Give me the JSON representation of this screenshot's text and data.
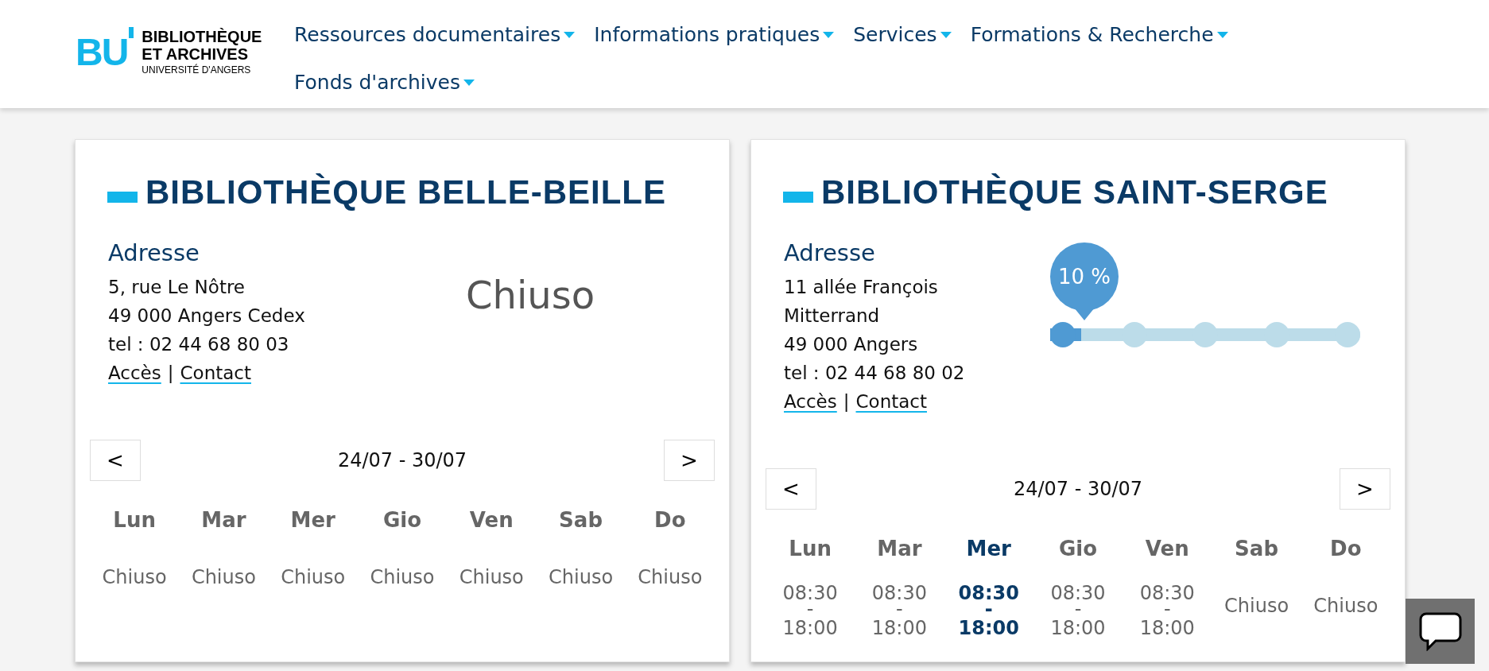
{
  "logo": {
    "mark": "BU",
    "lines": [
      "BIBLIOTHÈQUE",
      "ET ARCHIVES",
      "UNIVERSITÉ D'ANGERS"
    ]
  },
  "nav": [
    {
      "label": "Ressources documentaires"
    },
    {
      "label": "Informations pratiques"
    },
    {
      "label": "Services"
    },
    {
      "label": "Formations & Recherche"
    },
    {
      "label": "Fonds d'archives"
    }
  ],
  "libraries": [
    {
      "title": "BIBLIOTHÈQUE BELLE-BEILLE",
      "address_label": "Adresse",
      "address_lines": [
        "5, rue Le Nôtre",
        "49 000 Angers Cedex",
        "tel : 02 44 68 80 03"
      ],
      "links": [
        "Accès",
        "Contact"
      ],
      "link_separator": "|",
      "status": {
        "kind": "text",
        "text": "Chiuso"
      },
      "week": {
        "prev": "<",
        "range": "24/07 - 30/07",
        "next": ">"
      },
      "days": [
        {
          "name": "Lun",
          "selected": false,
          "kind": "closed",
          "text": "Chiuso"
        },
        {
          "name": "Mar",
          "selected": false,
          "kind": "closed",
          "text": "Chiuso"
        },
        {
          "name": "Mer",
          "selected": false,
          "kind": "closed",
          "text": "Chiuso"
        },
        {
          "name": "Gio",
          "selected": false,
          "kind": "closed",
          "text": "Chiuso"
        },
        {
          "name": "Ven",
          "selected": false,
          "kind": "closed",
          "text": "Chiuso"
        },
        {
          "name": "Sab",
          "selected": false,
          "kind": "closed",
          "text": "Chiuso"
        },
        {
          "name": "Do",
          "selected": false,
          "kind": "closed",
          "text": "Chiuso"
        }
      ]
    },
    {
      "title": "BIBLIOTHÈQUE SAINT-SERGE",
      "address_label": "Adresse",
      "address_lines": [
        "11 allée François",
        "Mitterrand",
        "49 000 Angers",
        "tel : 02 44 68 80 02"
      ],
      "links": [
        "Accès",
        "Contact"
      ],
      "link_separator": "|",
      "status": {
        "kind": "gauge",
        "level": 0.1,
        "reading": "10 %"
      },
      "week": {
        "prev": "<",
        "range": "24/07 - 30/07",
        "next": ">"
      },
      "days": [
        {
          "name": "Lun",
          "selected": false,
          "kind": "hours",
          "open": "08:30",
          "sep": "-",
          "close": "18:00"
        },
        {
          "name": "Mar",
          "selected": false,
          "kind": "hours",
          "open": "08:30",
          "sep": "-",
          "close": "18:00"
        },
        {
          "name": "Mer",
          "selected": true,
          "kind": "hours",
          "open": "08:30",
          "sep": "-",
          "close": "18:00"
        },
        {
          "name": "Gio",
          "selected": false,
          "kind": "hours",
          "open": "08:30",
          "sep": "-",
          "close": "18:00"
        },
        {
          "name": "Ven",
          "selected": false,
          "kind": "hours",
          "open": "08:30",
          "sep": "-",
          "close": "18:00"
        },
        {
          "name": "Sab",
          "selected": false,
          "kind": "closed",
          "text": "Chiuso"
        },
        {
          "name": "Do",
          "selected": false,
          "kind": "closed",
          "text": "Chiuso"
        }
      ]
    }
  ]
}
